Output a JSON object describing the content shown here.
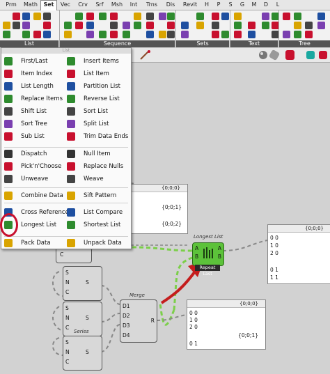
{
  "tabs": [
    "Prm",
    "Math",
    "Set",
    "Vec",
    "Crv",
    "Srf",
    "Msh",
    "Int",
    "Trns",
    "Dis",
    "Revit",
    "H",
    "P",
    "S",
    "G",
    "M",
    "D",
    "L"
  ],
  "active_tab": "Set",
  "ribbon_groups": {
    "list": "List",
    "sequence": "Sequence",
    "sets": "Sets",
    "text": "Text",
    "tree": "Tree"
  },
  "menu": {
    "header": "List",
    "left_items": [
      "First/Last",
      "Item Index",
      "List Length",
      "Replace Items",
      "Shift List",
      "Sort Tree",
      "Sub List",
      "Dispatch",
      "Pick'n'Choose",
      "Unweave",
      "Combine Data",
      "Cross Reference",
      "Longest List",
      "Pack Data"
    ],
    "right_items": [
      "Insert Items",
      "List Item",
      "Partition List",
      "Reverse List",
      "Sort List",
      "Split List",
      "Trim Data Ends",
      "Null Item",
      "Replace Nulls",
      "Weave",
      "Sift Pattern",
      "List Compare",
      "Shortest List",
      "Unpack Data"
    ]
  },
  "canvas": {
    "panel1": {
      "header": "{0;0;0}",
      "rows": [
        "{0;0;1}",
        "{0;0;2}"
      ]
    },
    "panel_right": {
      "header": "{0;0;0}",
      "rows": [
        "0 0",
        "1 0",
        "2 0",
        "0 1",
        "1 1"
      ]
    },
    "panel_bottom": {
      "header": "{0;0;0}",
      "rows": [
        "0 0",
        "1 0",
        "2 0",
        "{0;0;1}",
        "0 1"
      ]
    },
    "longest_list": {
      "title": "Longest List",
      "inputs": [
        "A",
        "B"
      ],
      "outputs": [
        "A",
        "B"
      ],
      "footer": "Repeat Last"
    },
    "merge": {
      "title": "Merge",
      "inputs": [
        "D1",
        "D2",
        "D3",
        "D4"
      ],
      "output": "R"
    },
    "series_label": "Series",
    "series_pins": [
      "S",
      "N",
      "C"
    ],
    "series_out": "S",
    "extra_pin": "C"
  },
  "colors": {
    "accent_red": "#c8102e",
    "component_green": "#5cc23a",
    "wire_green": "#7ccf4a",
    "arrow": "#c41d1d"
  }
}
